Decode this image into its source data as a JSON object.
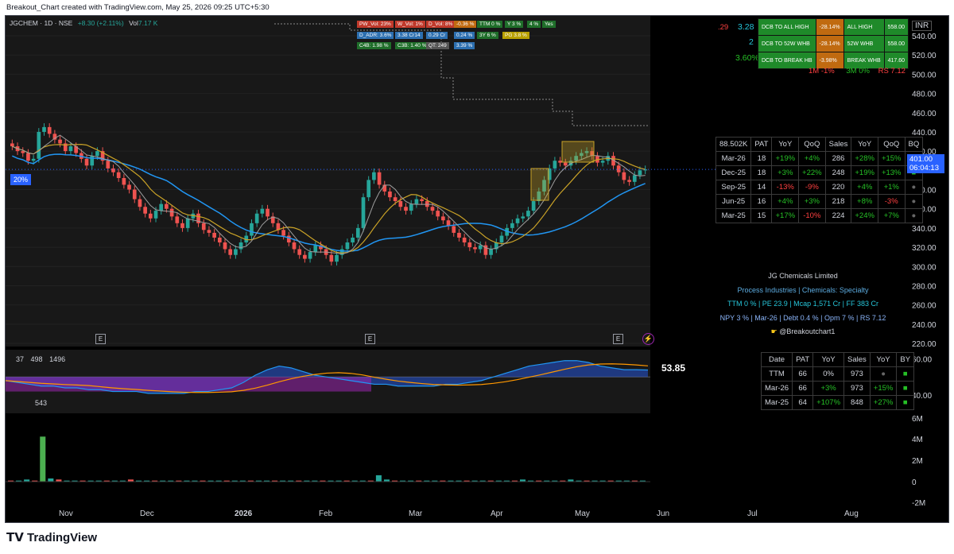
{
  "header_text": "Breakout_Chart created with TradingView.com, May 25, 2026 09:25 UTC+5:30",
  "symbol_line": {
    "symbol": "JGCHEM · 1D · NSE",
    "change": "+8.30 (+2.11%)",
    "vol_label": "Vol",
    "vol": "7.17 K"
  },
  "badges": [
    {
      "text": "PW_Vol: 23%",
      "color": "#c0392b"
    },
    {
      "text": "W_Vol: 1%",
      "color": "#c0392b"
    },
    {
      "text": "D_Vol: 8%",
      "color": "#c0392b"
    },
    {
      "text": "-0.36 %",
      "color": "#c06a10"
    },
    {
      "text": "TTM 0 %",
      "color": "#1f6e2a"
    },
    {
      "text": "Y 3 %",
      "color": "#1f6e2a"
    },
    {
      "text": "4 %",
      "color": "#1f6e2a"
    },
    {
      "text": "Yes",
      "color": "#1f6e2a"
    },
    {
      "text": "D_ADR: 3.6%",
      "color": "#2c6fb0"
    },
    {
      "text": "3.38 Cr14",
      "color": "#2c6fb0"
    },
    {
      "text": "0.29 Cr",
      "color": "#2c6fb0"
    },
    {
      "text": "0.24 %",
      "color": "#2c6fb0"
    },
    {
      "text": "3Y 6 %",
      "color": "#1f6e2a"
    },
    {
      "text": "PG 3.8 %",
      "color": "#b8a000"
    },
    {
      "text": "C4B: 1.98 %",
      "color": "#1f6e2a"
    },
    {
      "text": "C3B: 1.40 %",
      "color": "#1f6e2a"
    },
    {
      "text": "QT: 249",
      "color": "#555555"
    },
    {
      "text": "3.39 %",
      "color": "#2c6fb0"
    }
  ],
  "dcb": {
    "left_values": [
      ".29",
      "3.28",
      "2",
      "3.60%"
    ],
    "rows": [
      {
        "label": "DCB TO ALL HIGH",
        "pct": "-28.14%",
        "name": "ALL HIGH",
        "value": "558.00"
      },
      {
        "label": "DCB TO 52W WHB",
        "pct": "-28.14%",
        "name": "52W WHB",
        "value": "558.00"
      },
      {
        "label": "DCB TO BREAK HB",
        "pct": "-3.98%",
        "name": "BREAK WHB",
        "value": "417.60"
      }
    ],
    "perf": [
      "1M -1%",
      "3M 0%",
      "RS 7.12"
    ]
  },
  "currency": "INR",
  "price_badge": {
    "price": "401.00",
    "timer": "06:04:13"
  },
  "pct_badge": "20%",
  "quarterly_table": {
    "headers": [
      "88.502K",
      "PAT",
      "YoY",
      "QoQ",
      "Sales",
      "YoY",
      "QoQ",
      "BQ"
    ],
    "rows": [
      [
        "Mar-26",
        "18",
        "+19%",
        "+4%",
        "286",
        "+28%",
        "+15%",
        "■"
      ],
      [
        "Dec-25",
        "18",
        "+3%",
        "+22%",
        "248",
        "+19%",
        "+13%",
        "■"
      ],
      [
        "Sep-25",
        "14",
        "-13%",
        "-9%",
        "220",
        "+4%",
        "+1%",
        "●"
      ],
      [
        "Jun-25",
        "16",
        "+4%",
        "+3%",
        "218",
        "+8%",
        "-3%",
        "●"
      ],
      [
        "Mar-25",
        "15",
        "+17%",
        "-10%",
        "224",
        "+24%",
        "+7%",
        "●"
      ]
    ]
  },
  "company": {
    "name": "JG Chemicals Limited",
    "sector": "Process Industries | Chemicals: Specialty",
    "line1": "TTM 0 % | PE  23.9 | Mcap 1,571 Cr | FF 383 Cr",
    "line2": "NPY 3 % | Mar-26 | Debt 0.4 % | Opm 7 % | RS 7.12",
    "handle": "@Breakoutchart1"
  },
  "annual_table": {
    "headers": [
      "Date",
      "PAT",
      "YoY",
      "Sales",
      "YoY",
      "BY"
    ],
    "rows": [
      [
        "TTM",
        "66",
        "0%",
        "973",
        "●",
        "■"
      ],
      [
        "Mar-26",
        "66",
        "+3%",
        "973",
        "+15%",
        "■"
      ],
      [
        "Mar-25",
        "64",
        "+107%",
        "848",
        "+27%",
        "■"
      ]
    ]
  },
  "indicator": {
    "labels": [
      "37",
      "498",
      "1496"
    ],
    "low_label": "543",
    "value": "53.85"
  },
  "colors": {
    "up": "#26a69a",
    "down": "#ef5350",
    "ema_blue": "#2196f3",
    "ema_gold": "#c9a227",
    "ema_grey": "#9e9e9e"
  },
  "chart_data": [
    {
      "type": "line",
      "title": "JGCHEM · 1D · NSE",
      "x_ticks": [
        "Nov",
        "Dec",
        "2026",
        "Feb",
        "Mar",
        "Apr",
        "May",
        "Jun",
        "Jul",
        "Aug"
      ],
      "y_ticks": [
        540,
        520,
        500,
        480,
        460,
        440,
        420,
        400,
        380,
        360,
        340,
        320,
        300,
        280,
        260,
        240,
        220
      ],
      "ylim": [
        220,
        540
      ],
      "series": [
        {
          "values": [
            425,
            420,
            418,
            410,
            412,
            440,
            445,
            438,
            432,
            428,
            420,
            425,
            418,
            412,
            405,
            415,
            420,
            410,
            402,
            398,
            392,
            385,
            380,
            370,
            362,
            355,
            350,
            358,
            365,
            360,
            352,
            345,
            340,
            350,
            355,
            345,
            338,
            335,
            330,
            325,
            318,
            312,
            318,
            325,
            332,
            345,
            355,
            360,
            352,
            345,
            338,
            332,
            325,
            318,
            312,
            308,
            315,
            322,
            318,
            312,
            305,
            312,
            318,
            325,
            330,
            340,
            372,
            390,
            398,
            385,
            378,
            372,
            368,
            362,
            358,
            365,
            370,
            368,
            362,
            358,
            352,
            348,
            342,
            335,
            330,
            325,
            320,
            318,
            322,
            312,
            318,
            325,
            332,
            340,
            345,
            350,
            352,
            358,
            368,
            378,
            390,
            402,
            410,
            408,
            405,
            410,
            415,
            418,
            420,
            415,
            408,
            410,
            415,
            405,
            398,
            390,
            388,
            395,
            400,
            401
          ]
        }
      ]
    },
    {
      "type": "area",
      "ylim": [
        30,
        65
      ],
      "y_ticks": [
        60,
        40
      ],
      "series": [
        {
          "values": [
            48,
            47,
            46,
            45,
            45,
            44,
            44,
            43,
            43,
            42,
            42,
            42,
            41,
            41,
            41,
            41,
            42,
            42,
            43,
            44,
            47,
            51,
            54,
            56,
            55,
            53,
            51,
            50,
            49,
            48,
            47,
            46,
            46,
            45,
            45,
            45,
            45,
            46,
            46,
            47,
            48,
            50,
            52,
            54,
            56,
            57,
            58,
            59,
            59,
            58,
            56,
            55,
            54,
            54,
            53.85
          ]
        }
      ]
    },
    {
      "type": "bar",
      "ylim": [
        -2,
        6
      ],
      "y_ticks": [
        "6M",
        "4M",
        "2M",
        "0",
        "-2M"
      ],
      "series": [
        {
          "values": [
            0.1,
            0.1,
            0.2,
            0.1,
            4.2,
            0.3,
            0.2,
            0.1,
            0.1,
            0.1,
            0.1,
            0.1,
            0.1,
            0.1,
            0.1,
            0.2,
            0.1,
            0.1,
            0.1,
            0.1,
            0.1,
            0.1,
            0.1,
            0.1,
            0.1,
            0.1,
            0.1,
            0.1,
            0.1,
            0.1,
            0.1,
            0.1,
            0.1,
            0.1,
            0.1,
            0.1,
            0.1,
            0.1,
            0.1,
            0.1,
            0.1,
            0.1,
            0.1,
            0.1,
            0.1,
            0.1,
            0.6,
            0.2,
            0.1,
            0.1,
            0.1,
            0.1,
            0.1,
            0.1,
            0.1,
            0.1,
            0.1,
            0.1,
            0.1,
            0.1,
            0.1,
            0.1,
            0.1,
            0.1,
            0.2,
            0.1,
            0.1,
            0.1,
            0.1,
            0.1,
            0.2,
            0.1,
            0.1,
            0.1,
            0.1,
            0.1,
            0.1,
            0.1,
            0.1,
            0.1
          ]
        }
      ]
    }
  ]
}
